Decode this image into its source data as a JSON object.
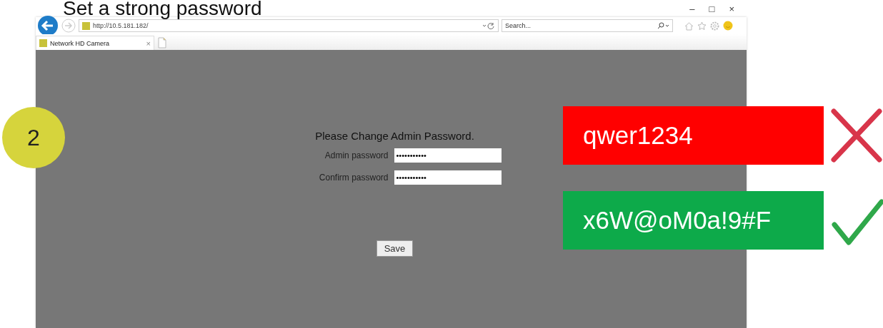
{
  "slide_title": "Set a strong password",
  "browser": {
    "window_controls": [
      "–",
      "□",
      "×"
    ],
    "address": "http://10.5.181.182/",
    "search": {
      "placeholder": "Search..."
    },
    "tabs": [
      {
        "label": "Network HD Camera",
        "close": "×"
      }
    ]
  },
  "page": {
    "heading": "Please Change Admin Password.",
    "fields": [
      {
        "label": "Admin password",
        "value": "•••••••••••"
      },
      {
        "label": "Confirm password",
        "value": "•••••••••••"
      }
    ],
    "button": "Save"
  },
  "step": "2",
  "examples": [
    {
      "kind": "weak",
      "text": "qwer1234"
    },
    {
      "kind": "strong",
      "text": "x6W@oM0a!9#F"
    }
  ]
}
